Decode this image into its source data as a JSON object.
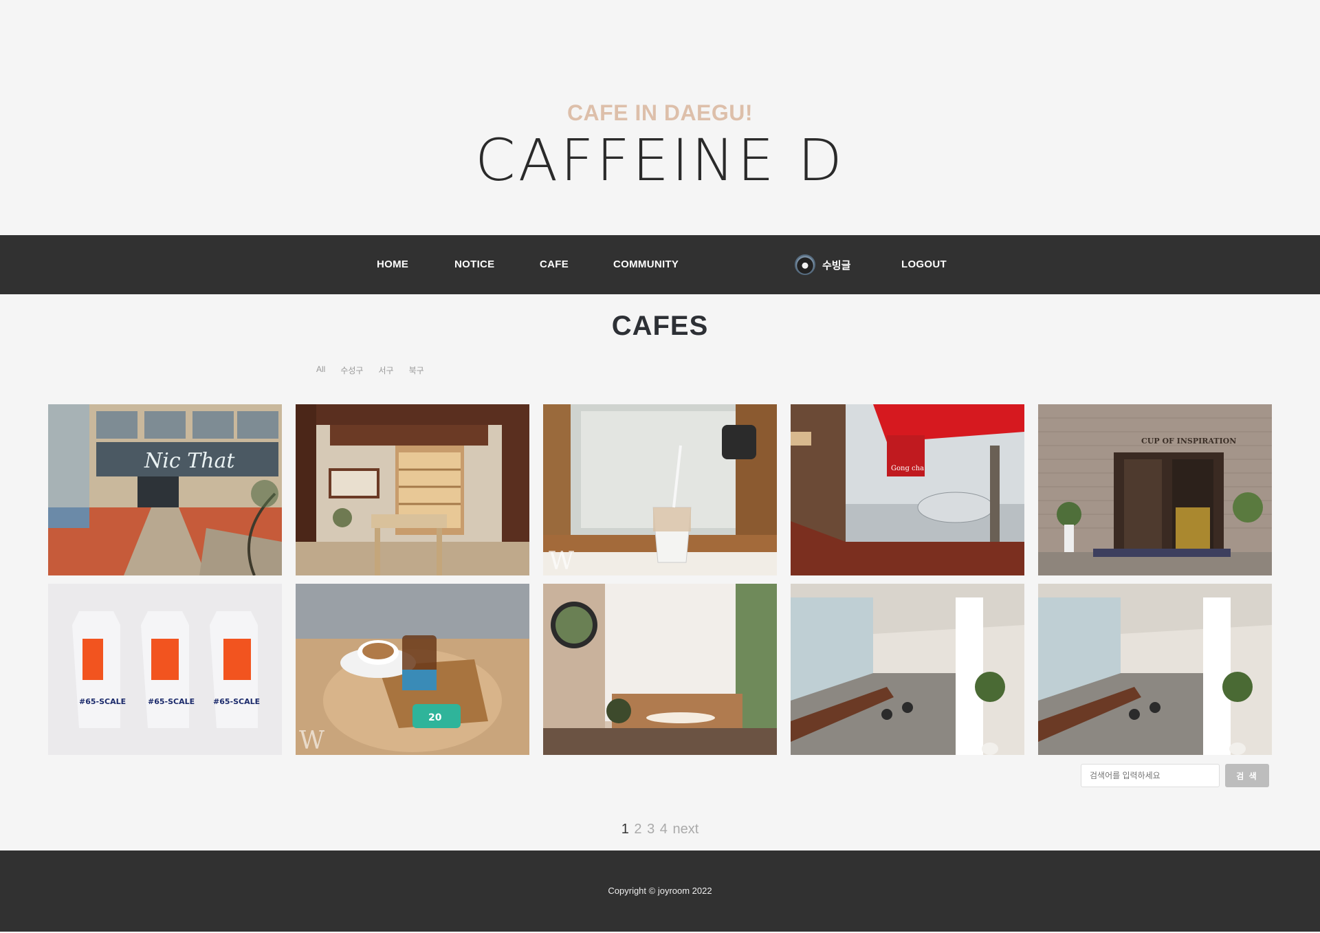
{
  "header": {
    "subtitle": "CAFE IN DAEGU!",
    "title": "CAFFEINE D"
  },
  "nav": {
    "items": [
      {
        "label": "HOME"
      },
      {
        "label": "NOTICE"
      },
      {
        "label": "CAFE"
      },
      {
        "label": "COMMUNITY"
      }
    ],
    "user": {
      "name": "수빙글"
    },
    "logout_label": "LOGOUT"
  },
  "main": {
    "heading": "CAFES",
    "filters": [
      "All",
      "수성구",
      "서구",
      "북구"
    ],
    "cards": [
      {
        "image": "modern-building-garden"
      },
      {
        "image": "wooden-hanok-interior"
      },
      {
        "image": "iced-latte-window"
      },
      {
        "image": "gong-cha-window-view"
      },
      {
        "image": "cup-of-inspiration-entrance"
      },
      {
        "image": "milk-carton-packages"
      },
      {
        "image": "latte-and-iced-drink-table"
      },
      {
        "image": "bright-cafe-interior-mirror"
      },
      {
        "image": "modern-cafe-seating-plant"
      },
      {
        "image": "modern-cafe-seating-plant"
      }
    ]
  },
  "search": {
    "placeholder": "검색어를 입력하세요",
    "button_label": "검 색"
  },
  "pagination": {
    "pages": [
      "1",
      "2",
      "3",
      "4"
    ],
    "current": "1",
    "next_label": "next"
  },
  "footer": {
    "copyright": "Copyright © joyroom 2022"
  },
  "colors": {
    "accent": "#ddbfaa",
    "nav_bg": "#313131",
    "page_bg": "#f5f5f5"
  }
}
